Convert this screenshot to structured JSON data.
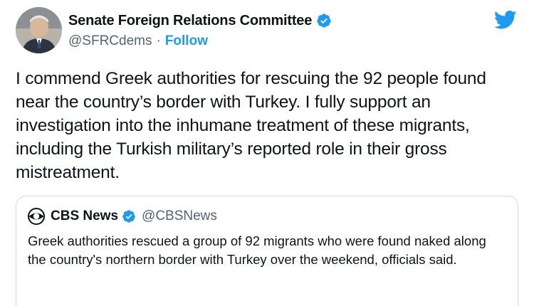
{
  "tweet": {
    "author_name": "Senate Foreign Relations Committee",
    "author_handle": "@SFRCdems",
    "separator": "·",
    "follow_label": "Follow",
    "text": "I commend Greek authorities for rescuing the 92 people found near the country’s border with Turkey. I fully support an investigation into the inhumane treatment of these migrants, including the Turkish military’s reported role in their gross mistreatment."
  },
  "quoted_tweet": {
    "author_name": "CBS News",
    "author_handle": "@CBSNews",
    "text": "Greek authorities rescued a group of 92 migrants who were found naked along the country's northern border with Turkey over the weekend, officials said."
  },
  "icons": {
    "verified": "verified-badge-icon",
    "brand": "twitter-bird-icon",
    "quoted_logo": "cbs-eye-logo-icon"
  },
  "colors": {
    "accent": "#1d9bf0",
    "text": "#0f1419",
    "secondary_text": "#536471",
    "border": "#cfd9de"
  }
}
